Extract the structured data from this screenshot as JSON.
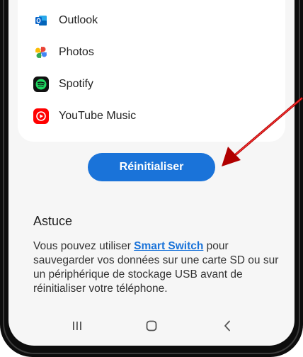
{
  "apps": [
    {
      "label": "Outlook",
      "icon": "outlook-icon",
      "color": "#0a64c8"
    },
    {
      "label": "Photos",
      "icon": "photos-icon",
      "color": "#4285f4"
    },
    {
      "label": "Spotify",
      "icon": "spotify-icon",
      "color": "#1ed760"
    },
    {
      "label": "YouTube Music",
      "icon": "youtube-music-icon",
      "color": "#ff0000"
    }
  ],
  "reset_button": {
    "label": "Réinitialiser",
    "color": "#1a73d9"
  },
  "tip": {
    "title": "Astuce",
    "text_before": "Vous pouvez utiliser ",
    "link": "Smart Switch",
    "text_after": " pour sauvegarder vos données sur une carte SD ou sur un périphérique de stockage USB avant de réinitialiser votre téléphone."
  },
  "navbar": {
    "recents_icon": "recents-icon",
    "home_icon": "home-icon",
    "back_icon": "back-icon"
  },
  "annotation": {
    "arrow_color": "#b00000"
  }
}
